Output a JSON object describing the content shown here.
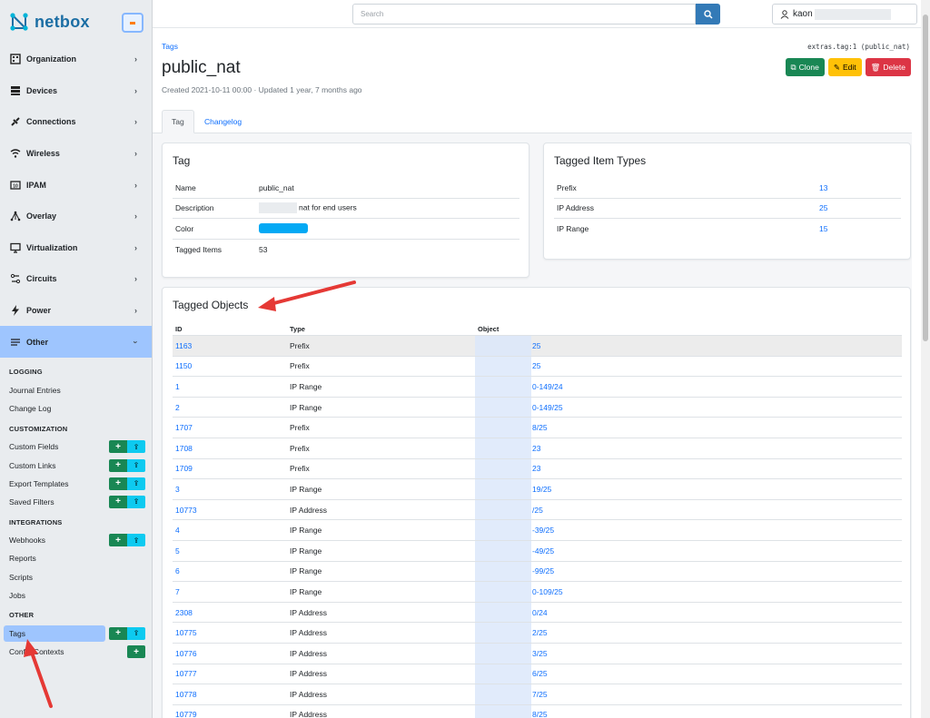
{
  "brand": {
    "name": "netbox"
  },
  "search": {
    "placeholder": "Search"
  },
  "user": {
    "name": "kaon"
  },
  "colors": {
    "brand": "#1c6ea4",
    "link": "#0d6efd",
    "clone": "#198754",
    "edit": "#ffc107",
    "delete": "#dc3545",
    "tag_color": "#03a9f4",
    "active_nav": "#9ec5fe"
  },
  "nav": [
    {
      "label": "Organization",
      "icon": "building-icon"
    },
    {
      "label": "Devices",
      "icon": "server-icon"
    },
    {
      "label": "Connections",
      "icon": "plug-icon"
    },
    {
      "label": "Wireless",
      "icon": "wifi-icon"
    },
    {
      "label": "IPAM",
      "icon": "counter-icon"
    },
    {
      "label": "Overlay",
      "icon": "graph-icon"
    },
    {
      "label": "Virtualization",
      "icon": "monitor-icon"
    },
    {
      "label": "Circuits",
      "icon": "transit-icon"
    },
    {
      "label": "Power",
      "icon": "flash-icon"
    },
    {
      "label": "Other",
      "icon": "notes-icon"
    }
  ],
  "submenu": {
    "logging": {
      "title": "LOGGING",
      "items": [
        "Journal Entries",
        "Change Log"
      ]
    },
    "customization": {
      "title": "CUSTOMIZATION",
      "items": [
        "Custom Fields",
        "Custom Links",
        "Export Templates",
        "Saved Filters"
      ]
    },
    "integrations": {
      "title": "INTEGRATIONS",
      "items": [
        "Webhooks",
        "Reports",
        "Scripts",
        "Jobs"
      ]
    },
    "other": {
      "title": "OTHER",
      "items": [
        "Tags",
        "Config Contexts"
      ]
    },
    "add_glyph": "+",
    "import_glyph": "⇪"
  },
  "page": {
    "breadcrumb": "Tags",
    "title": "public_nat",
    "meta": "Created 2021-10-11 00:00 · Updated 1 year, 7 months ago",
    "identifier": "extras.tag:1 (public_nat)",
    "actions": {
      "clone": "Clone",
      "edit": "Edit",
      "delete": "Delete"
    },
    "tabs": {
      "tag": "Tag",
      "changelog": "Changelog"
    }
  },
  "tag_card": {
    "title": "Tag",
    "rows": [
      {
        "key": "Name",
        "value": "public_nat"
      },
      {
        "key": "Description",
        "value": "nat for end users"
      },
      {
        "key": "Color",
        "value": ""
      },
      {
        "key": "Tagged Items",
        "value": "53"
      }
    ]
  },
  "types_card": {
    "title": "Tagged Item Types",
    "rows": [
      {
        "key": "Prefix",
        "value": "13"
      },
      {
        "key": "IP Address",
        "value": "25"
      },
      {
        "key": "IP Range",
        "value": "15"
      }
    ]
  },
  "objects_card": {
    "title": "Tagged Objects",
    "headers": {
      "id": "ID",
      "type": "Type",
      "object": "Object"
    },
    "rows": [
      {
        "id": "1163",
        "type": "Prefix",
        "object": "25"
      },
      {
        "id": "1150",
        "type": "Prefix",
        "object": "25"
      },
      {
        "id": "1",
        "type": "IP Range",
        "object": "0-149/24"
      },
      {
        "id": "2",
        "type": "IP Range",
        "object": "0-149/25"
      },
      {
        "id": "1707",
        "type": "Prefix",
        "object": "8/25"
      },
      {
        "id": "1708",
        "type": "Prefix",
        "object": "23"
      },
      {
        "id": "1709",
        "type": "Prefix",
        "object": "23"
      },
      {
        "id": "3",
        "type": "IP Range",
        "object": "19/25"
      },
      {
        "id": "10773",
        "type": "IP Address",
        "object": "/25"
      },
      {
        "id": "4",
        "type": "IP Range",
        "object": "-39/25"
      },
      {
        "id": "5",
        "type": "IP Range",
        "object": "-49/25"
      },
      {
        "id": "6",
        "type": "IP Range",
        "object": "-99/25"
      },
      {
        "id": "7",
        "type": "IP Range",
        "object": "0-109/25"
      },
      {
        "id": "2308",
        "type": "IP Address",
        "object": "0/24"
      },
      {
        "id": "10775",
        "type": "IP Address",
        "object": "2/25"
      },
      {
        "id": "10776",
        "type": "IP Address",
        "object": "3/25"
      },
      {
        "id": "10777",
        "type": "IP Address",
        "object": "6/25"
      },
      {
        "id": "10778",
        "type": "IP Address",
        "object": "7/25"
      },
      {
        "id": "10779",
        "type": "IP Address",
        "object": "8/25"
      }
    ]
  }
}
